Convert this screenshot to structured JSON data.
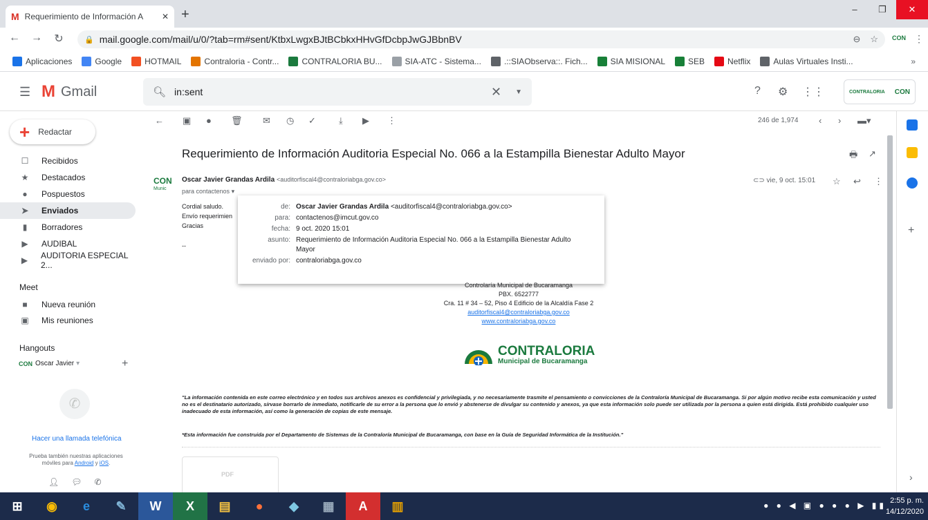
{
  "browser": {
    "tab_title": "Requerimiento de Información A",
    "favicon": "M",
    "new_tab": "+",
    "url": "mail.google.com/mail/u/0/?tab=rm#sent/KtbxLwgxBJtBCbkxHHvGfDcbpJwGJBbnBV",
    "bookmarks": [
      {
        "label": "Aplicaciones",
        "icon": "apps-icon",
        "color": "#1a73e8"
      },
      {
        "label": "Google",
        "icon": "google-icon",
        "color": "#4285f4"
      },
      {
        "label": "HOTMAIL",
        "icon": "windows-icon",
        "color": "#f25022"
      },
      {
        "label": "Contraloria - Contr...",
        "icon": "contraloria-icon",
        "color": "#e37400"
      },
      {
        "label": "CONTRALORIA BU...",
        "icon": "contraloria-icon",
        "color": "#1b7a3e"
      },
      {
        "label": "SIA-ATC - Sistema...",
        "icon": "doc-icon",
        "color": "#9aa0a6"
      },
      {
        "label": ".::SIAObserva::. Fich...",
        "icon": "sia-icon",
        "color": "#5f6368"
      },
      {
        "label": "SIA MISIONAL",
        "icon": "sia-icon",
        "color": "#188038"
      },
      {
        "label": "SEB",
        "icon": "seb-icon",
        "color": "#188038"
      },
      {
        "label": "Netflix",
        "icon": "netflix-icon",
        "color": "#e50914"
      },
      {
        "label": "Aulas Virtuales Insti...",
        "icon": "globe-icon",
        "color": "#5f6368"
      }
    ],
    "bookmarks_more": "»"
  },
  "gmail": {
    "logo_text": "Gmail",
    "search_value": "in:sent",
    "compose_label": "Redactar",
    "account_badge_1": "CONTRALORIA",
    "account_badge_2": "CON",
    "nav": [
      {
        "label": "Recibidos",
        "icon": "inbox-icon"
      },
      {
        "label": "Destacados",
        "icon": "star-icon"
      },
      {
        "label": "Pospuestos",
        "icon": "clock-icon"
      },
      {
        "label": "Enviados",
        "icon": "send-icon",
        "active": true
      },
      {
        "label": "Borradores",
        "icon": "draft-icon"
      },
      {
        "label": "AUDIBAL",
        "icon": "label-icon"
      },
      {
        "label": "AUDITORIA ESPECIAL 2...",
        "icon": "label-icon"
      }
    ],
    "meet_header": "Meet",
    "meet_items": [
      {
        "label": "Nueva reunión",
        "icon": "video-icon"
      },
      {
        "label": "Mis reuniones",
        "icon": "calendar-icon"
      }
    ],
    "hangouts_header": "Hangouts",
    "hangouts_user": "Oscar Javier",
    "hangouts_avatar": "CON",
    "call_link": "Hacer una llamada telefónica",
    "try_apps_text": "Prueba también nuestras aplicaciones móviles para",
    "try_android": "Android",
    "try_and": "y",
    "try_ios": "iOS",
    "page_info": "246 de 1,974"
  },
  "email": {
    "subject": "Requerimiento de Información Auditoria Especial No. 066 a la Estampilla Bienestar Adulto Mayor",
    "sender_avatar": "CON",
    "sender_avatar_sub": "Munic",
    "sender_name": "Oscar Javier Grandas Ardila",
    "sender_email": "<auditorfiscal4@contraloriabga.gov.co>",
    "to_short": "para contactenos",
    "date": "vie, 9 oct. 15:01",
    "body_lines": [
      "Cordial saludo.",
      "Envío requerimien",
      "Gracias",
      "--"
    ],
    "details": [
      {
        "label": "de:",
        "value_bold": "Oscar Javier Grandas Ardila",
        "value": "<auditorfiscal4@contraloriabga.gov.co>"
      },
      {
        "label": "para:",
        "value_bold": "",
        "value": "contactenos@imcut.gov.co"
      },
      {
        "label": "fecha:",
        "value_bold": "",
        "value": "9 oct. 2020 15:01"
      },
      {
        "label": "asunto:",
        "value_bold": "",
        "value": "Requerimiento de Información Auditoria Especial No. 066 a la Estampilla Bienestar Adulto Mayor"
      },
      {
        "label": "enviado por:",
        "value_bold": "",
        "value": "contraloriabga.gov.co"
      }
    ],
    "signature": [
      "Controlaría Municipal de Bucaramanga",
      "PBX. 6522777",
      "Cra. 11 # 34 – 52, Piso 4 Edificio de la Alcaldía Fase 2"
    ],
    "sig_email": "auditorfiscal4@contraloriabga.gov.co",
    "sig_web": "www.contraloriabga.gov.co",
    "logo_title": "CONTRALORIA",
    "logo_sub": "Municipal de Bucaramanga",
    "disclaimer1": "\"La información contenida en este correo electrónico y en todos sus archivos anexos es confidencial y privilegiada, y no necesariamente trasmite el pensamiento o convicciones de la Contraloría Municipal de Bucaramanga.  Si por algún motivo recibe esta comunicación y usted no es el destinatario autorizado, sírvase borrarlo de inmediato, notificarle de su error a la persona que lo envió y abstenerse de divulgar su contenido y anexos, ya que esta información solo puede ser utilizada por la persona a quien está dirigida. Está prohibido cualquier uso inadecuado de esta información, así como la generación de copias de este mensaje.",
    "disclaimer2": "*Esta información fue construida por el Departamento de Sistemas de la Contraloría Municipal de Bucaramanga, con base en la Guía de Seguridad Informática de la Institución.\"",
    "attachment_label": "PDF"
  },
  "taskbar": {
    "time": "2:55 p. m.",
    "date": "14/12/2020"
  },
  "colors": {
    "accent": "#1a73e8",
    "gmail_red": "#ea4335",
    "contraloria_green": "#1b7a3e",
    "taskbar": "#1c2b4a"
  }
}
